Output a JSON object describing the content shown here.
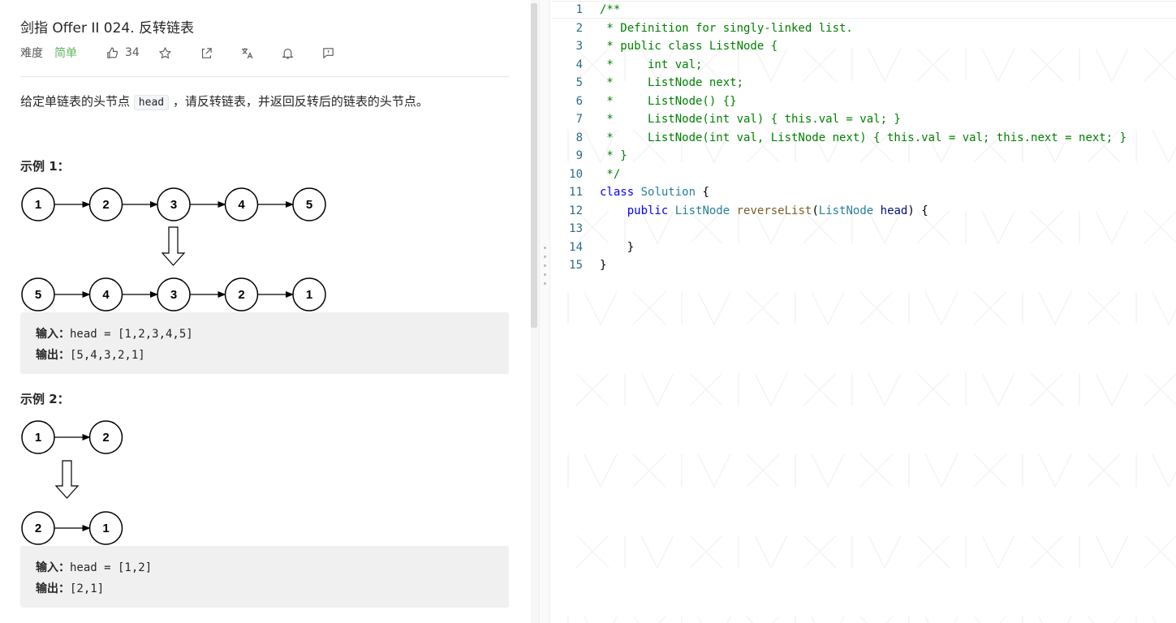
{
  "problem": {
    "title": "剑指 Offer II 024. 反转链表",
    "difficulty_label": "难度",
    "difficulty_value": "简单",
    "likes": "34",
    "icons": [
      "like-icon",
      "star-icon",
      "share-icon",
      "translate-icon",
      "bell-icon",
      "feedback-icon"
    ],
    "description_before": "给定单链表的头节点",
    "description_code": "head",
    "description_after": "，请反转链表，并返回反转后的链表的头节点。"
  },
  "examples": [
    {
      "title": "示例 1：",
      "list_before": [
        "1",
        "2",
        "3",
        "4",
        "5"
      ],
      "list_after": [
        "5",
        "4",
        "3",
        "2",
        "1"
      ],
      "input_label": "输入：",
      "input_value": "head = [1,2,3,4,5]",
      "output_label": "输出：",
      "output_value": "[5,4,3,2,1]"
    },
    {
      "title": "示例 2：",
      "list_before": [
        "1",
        "2"
      ],
      "list_after": [
        "2",
        "1"
      ],
      "input_label": "输入：",
      "input_value": "head = [1,2]",
      "output_label": "输出：",
      "output_value": "[2,1]"
    }
  ],
  "editor": {
    "line_numbers": [
      "1",
      "2",
      "3",
      "4",
      "5",
      "6",
      "7",
      "8",
      "9",
      "10",
      "11",
      "12",
      "13",
      "14",
      "15"
    ],
    "lines": [
      "/**",
      " * Definition for singly-linked list.",
      " * public class ListNode {",
      " *     int val;",
      " *     ListNode next;",
      " *     ListNode() {}",
      " *     ListNode(int val) { this.val = val; }",
      " *     ListNode(int val, ListNode next) { this.val = val; this.next = next; }",
      " * }",
      " */",
      "class Solution {",
      "    public ListNode reverseList(ListNode head) {",
      "",
      "    }",
      "}"
    ]
  },
  "colors": {
    "comment": "#008000",
    "keyword": "#0000ff",
    "type": "#267f99",
    "function": "#795e26",
    "param": "#001080",
    "line_number": "#2b6c8a",
    "easy": "#5cb85c"
  }
}
